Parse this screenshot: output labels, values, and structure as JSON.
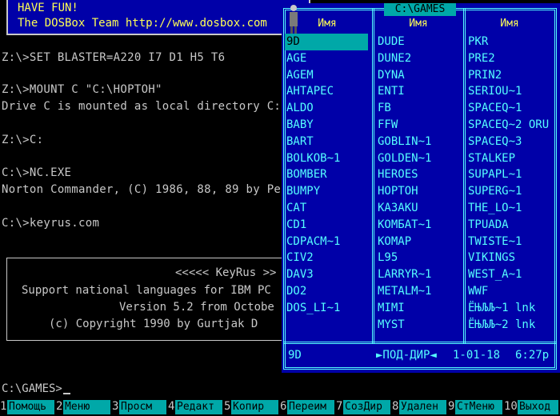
{
  "welcome": {
    "line1": "HAVE FUN!",
    "line2": "The DOSBox Team http://www.dosbox.com"
  },
  "console": {
    "lines": [
      "Z:\\>SET BLASTER=A220 I7 D1 H5 T6",
      "",
      "Z:\\>MOUNT C \"C:\\НОРТОН\"",
      "Drive C is mounted as local directory C:",
      "",
      "Z:\\>C:",
      "",
      "C:\\>NC.EXE",
      "Norton Commander, (C) 1986, 88, 89 by Pe",
      "",
      "C:\\>keyrus.com"
    ]
  },
  "keyrus": {
    "title": "<<<<< KeyRus >>",
    "line1": "Support national languages for IBM PC",
    "line2": "Version 5.2 from Octobe",
    "line3": "(c) Copyright 1990 by Gurtjak D"
  },
  "panel": {
    "title": "C:\\GAMES",
    "col_header": "Имя",
    "col1": [
      "9D",
      "AGE",
      "AGEM",
      "AHTAPEC",
      "ALDO",
      "BABY",
      "BART",
      "BOLKOB~1",
      "BOMBER",
      "BUMPY",
      "CAT",
      "CD1",
      "CDPACM~1",
      "CIV2",
      "DAV3",
      "DO2",
      "DOS_LI~1"
    ],
    "col2": [
      "DUDE",
      "DUNE2",
      "DYNA",
      "ENTI",
      "FB",
      "FFW",
      "GOBLIN~1",
      "GOLDEN~1",
      "HEROES",
      "HOPTOH",
      "KA3AKU",
      "KOMБAT~1",
      "KOMAP",
      "L95",
      "LARRYR~1",
      "METALM~1",
      "MIMI",
      "MYST"
    ],
    "col3": [
      "PKR",
      "PRE2",
      "PRIN2",
      "SERIOU~1",
      "SPACEQ~1",
      "SPACEQ~2 ORU",
      "SPACEQ~3",
      "STALKEP",
      "SUPAPL~1",
      "SUPERG~1",
      "THE_LO~1",
      "TPUADA",
      "TWISTE~1",
      "VIKINGS",
      "WEST_A~1",
      "WWF",
      "ЁЊЉЉ~1 lnk",
      "ЁЊЉЉ~2 lnk"
    ],
    "selected": "9D",
    "status": {
      "name": "9D",
      "type": "►ПОД-ДИР◄",
      "date": "1-01-18",
      "time": "6:27p"
    }
  },
  "prompt": "C:\\GAMES>",
  "keybar": [
    {
      "num": "1",
      "label": "Помощь"
    },
    {
      "num": "2",
      "label": "Меню"
    },
    {
      "num": "3",
      "label": "Просм"
    },
    {
      "num": "4",
      "label": "Редакт"
    },
    {
      "num": "5",
      "label": "Копир"
    },
    {
      "num": "6",
      "label": "Переим"
    },
    {
      "num": "7",
      "label": "СозДир"
    },
    {
      "num": "8",
      "label": "Удален"
    },
    {
      "num": "9",
      "label": "СтМеню"
    },
    {
      "num": "10",
      "label": "Выход"
    }
  ],
  "colors": {
    "panel_bg": "#0000a8",
    "panel_fg": "#55ffff",
    "header_fg": "#ffff55",
    "cursor_bg": "#00a8a8"
  }
}
